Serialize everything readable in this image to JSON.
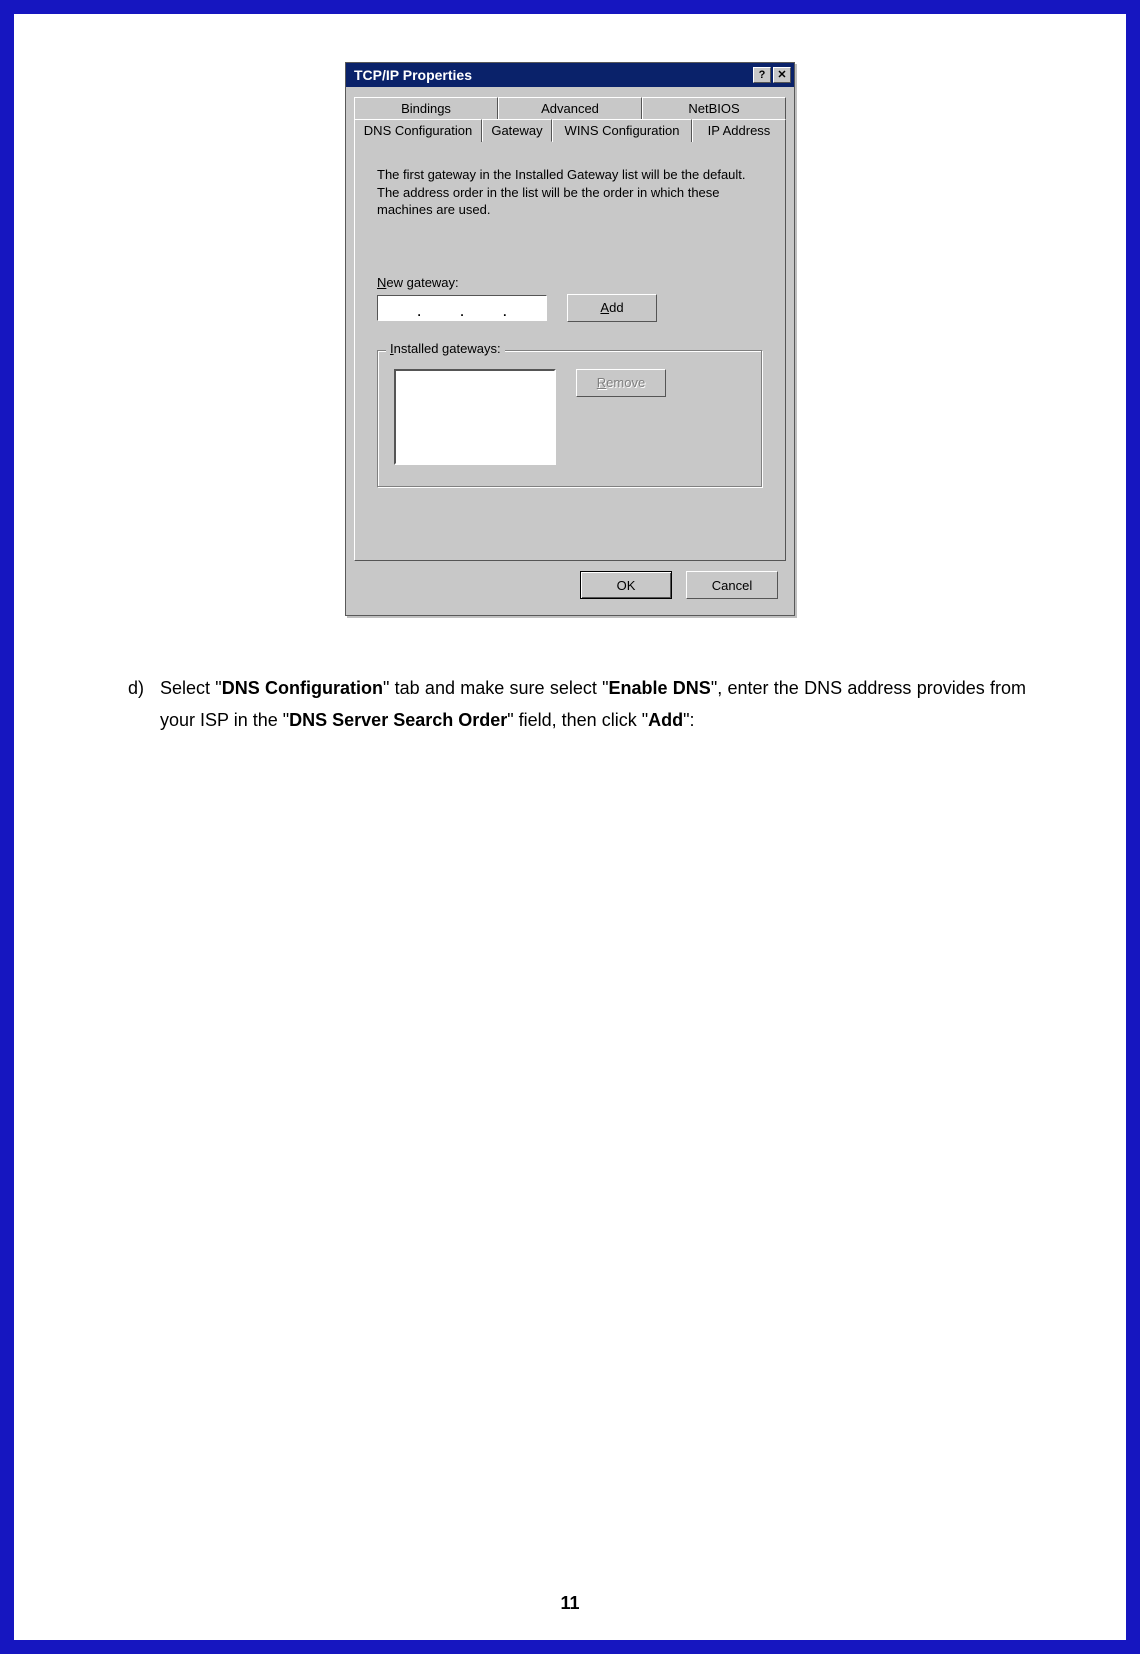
{
  "dialog": {
    "title": "TCP/IP Properties",
    "help_icon": "?",
    "close_icon": "✕",
    "tabs_row1": [
      "Bindings",
      "Advanced",
      "NetBIOS"
    ],
    "tabs_row2": [
      "DNS Configuration",
      "Gateway",
      "WINS Configuration",
      "IP Address"
    ],
    "active_tab": "Gateway",
    "description": "The first gateway in the Installed Gateway list will be the default. The address order in the list will be the order in which these machines are used.",
    "new_gateway_label_prefix": "N",
    "new_gateway_label_rest": "ew gateway:",
    "add_button_prefix": "A",
    "add_button_rest": "dd",
    "installed_label_prefix": "I",
    "installed_label_rest": "nstalled gateways:",
    "remove_button_prefix": "R",
    "remove_button_rest": "emove",
    "ok_button": "OK",
    "cancel_button": "Cancel"
  },
  "instruction": {
    "marker": "d)",
    "text_1": "Select \"",
    "bold_1": "DNS Configuration",
    "text_2": "\" tab and make sure select \"",
    "bold_2": "Enable DNS",
    "text_3": "\", enter the DNS address provides from your ISP in the \"",
    "bold_3": "DNS Server Search Order",
    "text_4": "\" field, then click \"",
    "bold_4": "Add",
    "text_5": "\":"
  },
  "page_number": "11"
}
